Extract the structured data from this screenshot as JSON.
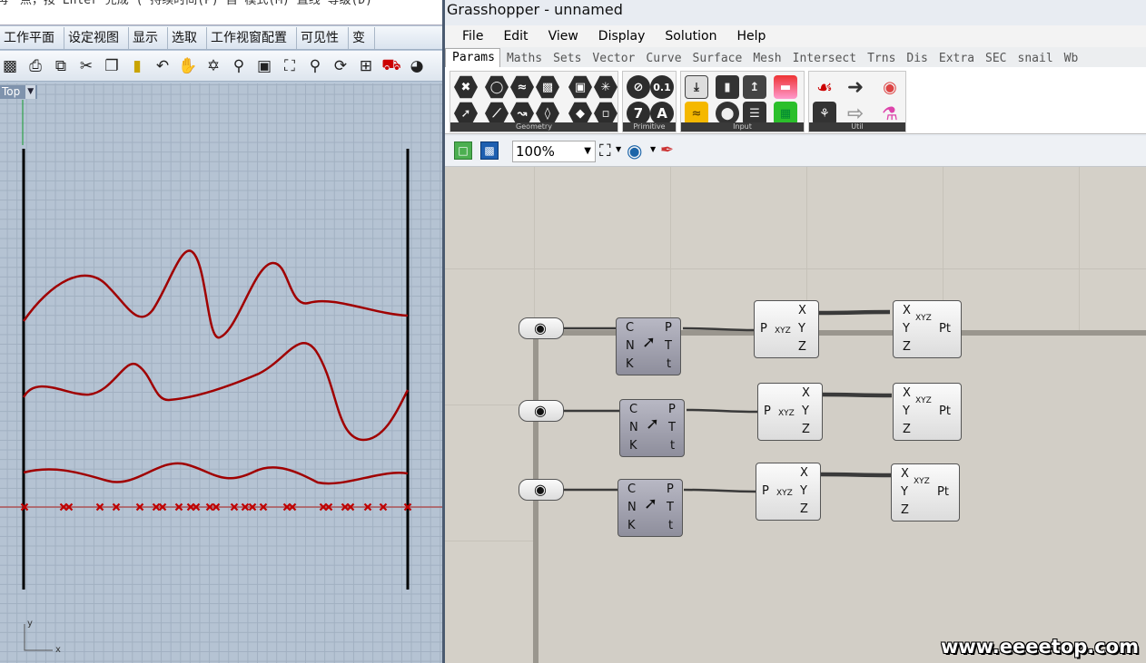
{
  "rhino": {
    "command_line": "再一点，按 Enter 完成 ( 持续时间(P) 自 模式(M) 直线 等级(D)",
    "tabs": [
      "工作平面",
      "设定视图",
      "显示",
      "选取",
      "工作视窗配置",
      "可见性",
      "变"
    ],
    "viewport": {
      "name": "Top",
      "axis_x": "x",
      "axis_y": "y"
    },
    "curve_color": "#a00000",
    "points_color": "#c00000"
  },
  "grasshopper": {
    "title": "Grasshopper - unnamed",
    "menu": [
      "File",
      "Edit",
      "View",
      "Display",
      "Solution",
      "Help"
    ],
    "tabs": [
      "Params",
      "Maths",
      "Sets",
      "Vector",
      "Curve",
      "Surface",
      "Mesh",
      "Intersect",
      "Trns",
      "Dis",
      "Extra",
      "SEC",
      "snail",
      "Wb"
    ],
    "active_tab": "Params",
    "ribbon_groups": [
      "Geometry",
      "Primitive",
      "Input",
      "Util"
    ],
    "primitive_icons": [
      "0.1",
      "7",
      "A"
    ],
    "zoom": "100%",
    "components": {
      "eval": {
        "inputs": [
          "C",
          "N",
          "K"
        ],
        "outputs": [
          "P",
          "T",
          "t"
        ]
      },
      "deconstruct": {
        "input": "P",
        "outputs": [
          "X",
          "Y",
          "Z"
        ],
        "icon_text": "XYZ"
      },
      "construct": {
        "inputs": [
          "X",
          "Y",
          "Z"
        ],
        "output": "Pt",
        "icon_text": "XYZ"
      }
    }
  },
  "watermark": "www.eeeetop.com"
}
